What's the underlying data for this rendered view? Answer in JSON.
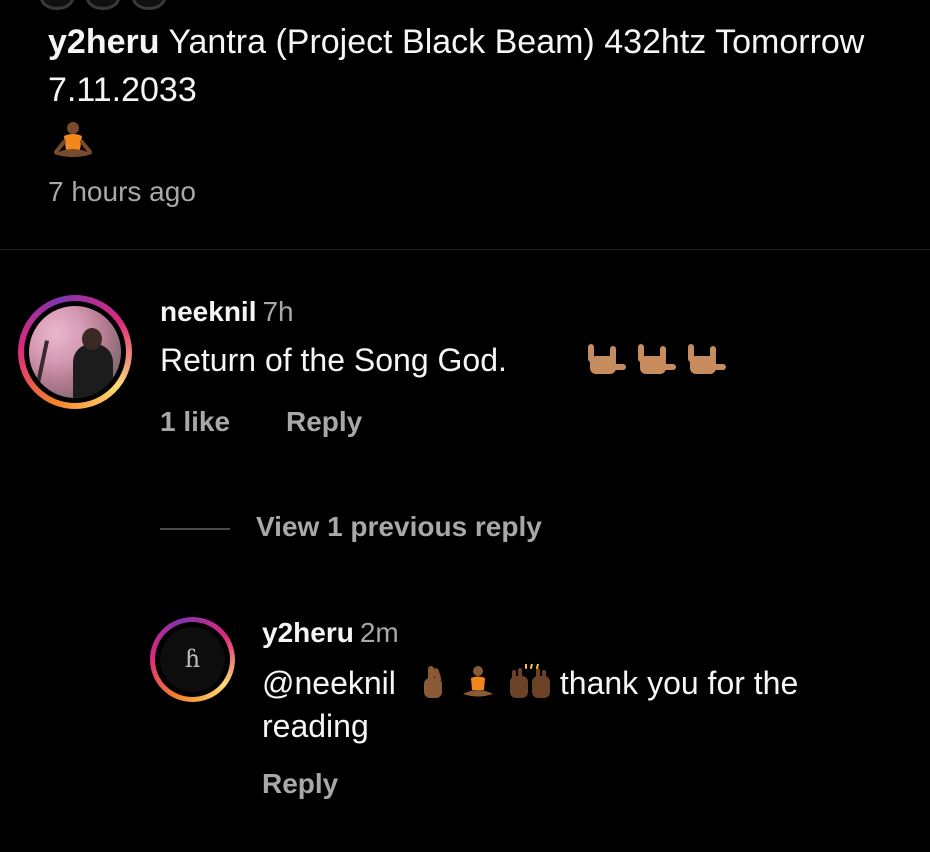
{
  "post": {
    "caption_user": "y2heru",
    "caption_text": "Yantra (Project Black Beam) 432htz Tomorrow 7.11.2033",
    "caption_emoji": "person-in-lotus-position-emoji",
    "time": "7 hours ago"
  },
  "comments": [
    {
      "username": "neeknil",
      "time": "7h",
      "text": "Return of the Song God.",
      "emojis": [
        "sign-of-the-horns-emoji",
        "sign-of-the-horns-emoji",
        "sign-of-the-horns-emoji"
      ],
      "likes_label": "1 like",
      "reply_label": "Reply",
      "view_replies_label": "View 1 previous reply",
      "replies": [
        {
          "username": "y2heru",
          "time": "2m",
          "mention": "@neeknil",
          "emojis": [
            "crossed-fingers-emoji",
            "person-in-lotus-position-emoji",
            "raising-hands-emoji"
          ],
          "text": "thank you for the reading",
          "reply_label": "Reply"
        }
      ]
    }
  ],
  "colors": {
    "background": "#000000",
    "primary_text": "#f5f5f5",
    "secondary_text": "#a8a8a8",
    "divider": "#262626"
  }
}
